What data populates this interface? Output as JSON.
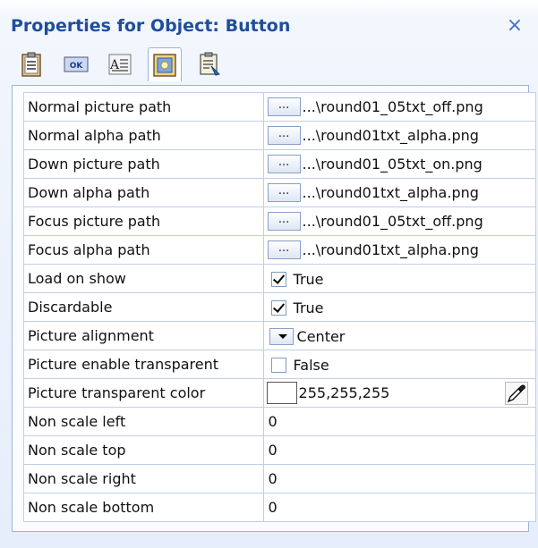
{
  "window": {
    "title": "Properties for Object: Button",
    "close_glyph": "×"
  },
  "toolbar": {
    "buttons": [
      {
        "name": "clipboard-icon",
        "active": false
      },
      {
        "name": "ok-button-icon",
        "label": "OK",
        "active": false
      },
      {
        "name": "text-field-icon",
        "label": "A",
        "active": false
      },
      {
        "name": "picture-icon",
        "active": true
      },
      {
        "name": "event-list-icon",
        "active": false
      }
    ]
  },
  "properties": {
    "rows": [
      {
        "name": "Normal picture path",
        "type": "path",
        "dots": "...",
        "value": "...\\round01_05txt_off.png"
      },
      {
        "name": "Normal alpha path",
        "type": "path",
        "dots": "...",
        "value": "...\\round01txt_alpha.png"
      },
      {
        "name": "Down picture path",
        "type": "path",
        "dots": "...",
        "value": "...\\round01_05txt_on.png"
      },
      {
        "name": "Down alpha path",
        "type": "path",
        "dots": "...",
        "value": "...\\round01txt_alpha.png"
      },
      {
        "name": "Focus picture path",
        "type": "path",
        "dots": "...",
        "value": "...\\round01_05txt_off.png"
      },
      {
        "name": "Focus alpha path",
        "type": "path",
        "dots": "...",
        "value": "...\\round01txt_alpha.png"
      },
      {
        "name": "Load on show",
        "type": "check",
        "checked": true,
        "value": "True"
      },
      {
        "name": "Discardable",
        "type": "check",
        "checked": true,
        "value": "True"
      },
      {
        "name": "Picture alignment",
        "type": "select",
        "value": "Center"
      },
      {
        "name": "Picture enable transparent",
        "type": "check",
        "checked": false,
        "value": "False"
      },
      {
        "name": "Picture transparent color",
        "type": "color",
        "color": "#ffffff",
        "value": "255,255,255"
      },
      {
        "name": "Non scale left",
        "type": "number",
        "value": "0"
      },
      {
        "name": "Non scale top",
        "type": "number",
        "value": "0"
      },
      {
        "name": "Non scale right",
        "type": "number",
        "value": "0"
      },
      {
        "name": "Non scale bottom",
        "type": "number",
        "value": "0"
      }
    ]
  },
  "colors": {
    "title": "#1f4d9c",
    "accent": "#4472c4",
    "grid_line": "#bfcfe8"
  }
}
